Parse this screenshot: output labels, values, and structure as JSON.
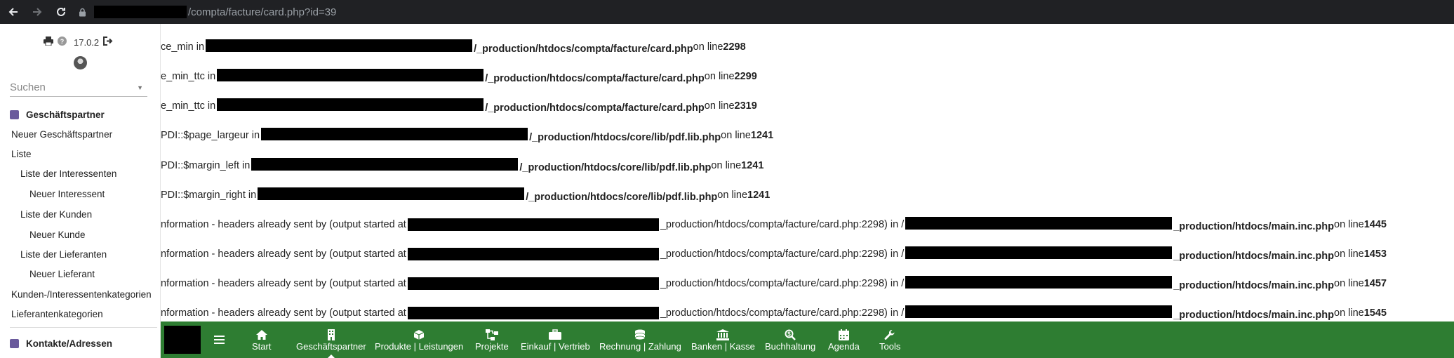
{
  "browser": {
    "url_path": "/compta/facture/card.php?id=39"
  },
  "sidebar": {
    "version": "17.0.2",
    "search_placeholder": "Suchen",
    "sections": [
      {
        "title": "Geschäftspartner",
        "items": [
          {
            "label": "Neuer Geschäftspartner"
          },
          {
            "label": "Liste"
          },
          {
            "label": "Liste der Interessenten"
          },
          {
            "label": "Neuer Interessent"
          },
          {
            "label": "Liste der Kunden"
          },
          {
            "label": "Neuer Kunde"
          },
          {
            "label": "Liste der Lieferanten"
          },
          {
            "label": "Neuer Lieferant"
          },
          {
            "label": "Kunden-/Interessentenkategorien"
          },
          {
            "label": "Lieferantenkategorien"
          }
        ]
      },
      {
        "title": "Kontakte/Adressen",
        "items": []
      }
    ]
  },
  "errors": [
    {
      "pre": "ce_min in ",
      "post_bold": "_production/htdocs/compta/facture/card.php",
      "mid": " on line ",
      "line": "2298"
    },
    {
      "pre": "e_min_ttc in ",
      "post_bold": "_production/htdocs/compta/facture/card.php",
      "mid": " on line ",
      "line": "2299"
    },
    {
      "pre": "e_min_ttc in ",
      "post_bold": "_production/htdocs/compta/facture/card.php",
      "mid": " on line ",
      "line": "2319"
    },
    {
      "pre": "PDI::$page_largeur in ",
      "post_bold": "_production/htdocs/core/lib/pdf.lib.php",
      "mid": " on line ",
      "line": "1241"
    },
    {
      "pre": "PDI::$margin_left in ",
      "post_bold": "_production/htdocs/core/lib/pdf.lib.php",
      "mid": " on line ",
      "line": "1241"
    },
    {
      "pre": "PDI::$margin_right in ",
      "post_bold": "_production/htdocs/core/lib/pdf.lib.php",
      "mid": " on line ",
      "line": "1241"
    },
    {
      "pre": "nformation - headers already sent by (output started at ",
      "plain_mid": "_production/htdocs/compta/facture/card.php:2298) in /",
      "post_bold": "_production/htdocs/main.inc.php",
      "mid": " on line ",
      "line": "1445"
    },
    {
      "pre": "nformation - headers already sent by (output started at ",
      "plain_mid": "_production/htdocs/compta/facture/card.php:2298) in /",
      "post_bold": "_production/htdocs/main.inc.php",
      "mid": " on line ",
      "line": "1453"
    },
    {
      "pre": "nformation - headers already sent by (output started at ",
      "plain_mid": "_production/htdocs/compta/facture/card.php:2298) in /",
      "post_bold": "_production/htdocs/main.inc.php",
      "mid": " on line ",
      "line": "1457"
    },
    {
      "pre": "nformation - headers already sent by (output started at ",
      "plain_mid": "_production/htdocs/compta/facture/card.php:2298) in /",
      "post_bold": "_production/htdocs/main.inc.php",
      "mid": " on line ",
      "line": "1545"
    }
  ],
  "bottom_nav": {
    "items": [
      {
        "label": "Start",
        "icon": "home-icon"
      },
      {
        "label": "Geschäftspartner",
        "icon": "building-icon",
        "active": true
      },
      {
        "label": "Produkte | Leistungen",
        "icon": "cube-icon"
      },
      {
        "label": "Projekte",
        "icon": "sitemap-icon"
      },
      {
        "label": "Einkauf | Vertrieb",
        "icon": "briefcase-icon"
      },
      {
        "label": "Rechnung | Zahlung",
        "icon": "coins-icon"
      },
      {
        "label": "Banken | Kasse",
        "icon": "bank-icon"
      },
      {
        "label": "Buchhaltung",
        "icon": "search-dollar-icon"
      },
      {
        "label": "Agenda",
        "icon": "calendar-icon"
      },
      {
        "label": "Tools",
        "icon": "wrench-icon"
      }
    ]
  },
  "colors": {
    "nav_green": "#2e7d32",
    "browser_bar": "#202124",
    "menu_icon": "#6a5a9c"
  }
}
